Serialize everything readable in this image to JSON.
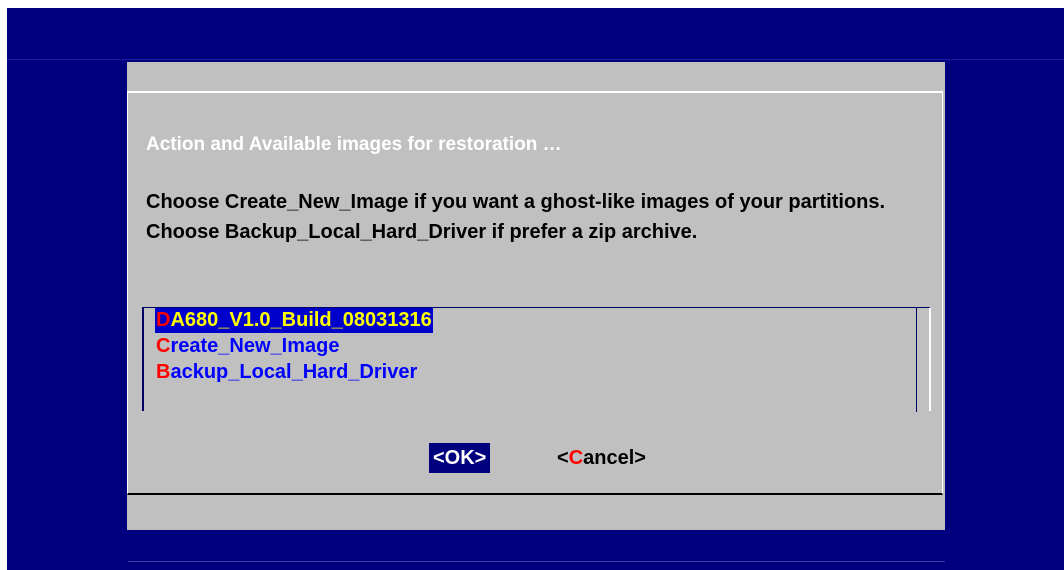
{
  "dialog": {
    "title": "Action and Available images for restoration …",
    "message": "Choose Create_New_Image if you want a ghost-like images of your partitions. Choose Backup_Local_Hard_Driver if prefer a zip archive.",
    "items": [
      {
        "hotkey": "D",
        "rest": "A680_V1.0_Build_08031316",
        "selected": true
      },
      {
        "hotkey": "C",
        "rest": "reate_New_Image",
        "selected": false
      },
      {
        "hotkey": "B",
        "rest": "ackup_Local_Hard_Driver",
        "selected": false
      }
    ],
    "buttons": {
      "ok": {
        "label": "<OK>"
      },
      "cancel": {
        "open": "<",
        "hotkey": "C",
        "rest": "ancel>"
      }
    }
  },
  "colors": {
    "background": "#00007f",
    "dialog": "#c0c0c0",
    "hotkey": "#ff0000",
    "item_text": "#0000ff",
    "selected_bg": "#0000cc",
    "selected_text": "#ffff00"
  }
}
